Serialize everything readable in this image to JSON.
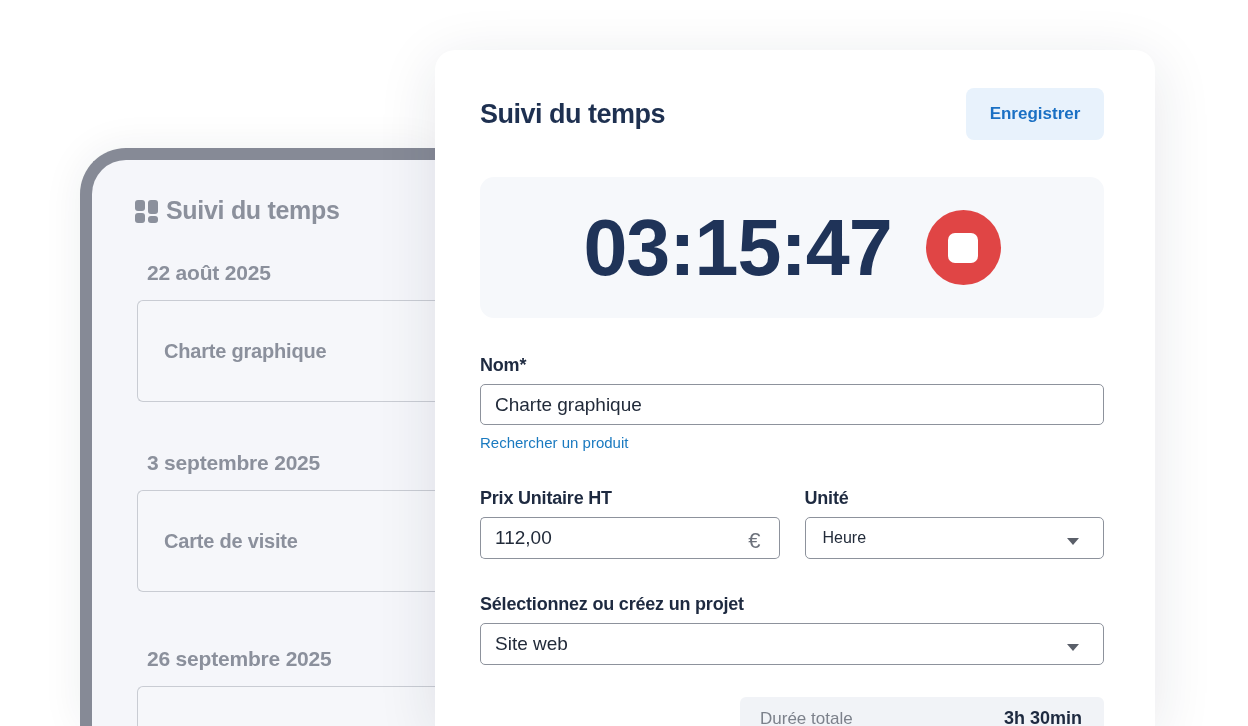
{
  "background_app": {
    "title": "Suivi du temps",
    "entries": [
      {
        "date": "22 août 2025",
        "name": "Charte graphique"
      },
      {
        "date": "3 septembre 2025",
        "name": "Carte de visite"
      },
      {
        "date": "26 septembre 2025"
      }
    ]
  },
  "time_card": {
    "title": "Suivi du temps",
    "save_button": "Enregistrer",
    "timer": {
      "display": "03:15:47",
      "running": true
    },
    "name_field": {
      "label": "Nom*",
      "value": "Charte graphique",
      "link": "Rechercher un produit"
    },
    "price_field": {
      "label": "Prix Unitaire HT",
      "value": "112,00",
      "currency": "€"
    },
    "unit_field": {
      "label": "Unité",
      "value": "Heure"
    },
    "project_field": {
      "label": "Sélectionnez ou créez un projet",
      "value": "Site web"
    },
    "summary": {
      "label": "Durée totale",
      "value": "3h 30min"
    }
  }
}
